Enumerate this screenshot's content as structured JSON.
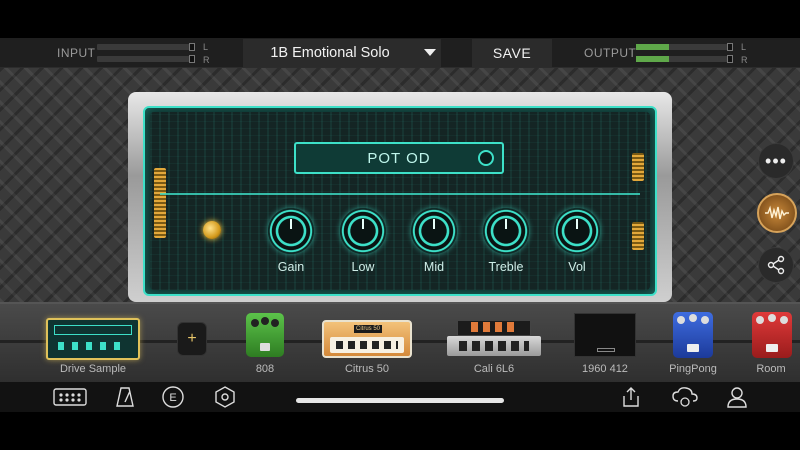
{
  "topbar": {
    "input_label": "INPUT",
    "output_label": "OUTPUT",
    "channel_l": "L",
    "channel_r": "R",
    "input_meter_l": 0.0,
    "input_meter_r": 0.0,
    "output_meter_l": 0.35,
    "output_meter_r": 0.35,
    "preset_name": "1B Emotional Solo",
    "save_label": "SAVE"
  },
  "amp": {
    "name": "POT OD",
    "knobs": [
      {
        "label": "Gain"
      },
      {
        "label": "Low"
      },
      {
        "label": "Mid"
      },
      {
        "label": "Treble"
      },
      {
        "label": "Vol"
      }
    ],
    "accent_color": "#3de0c8"
  },
  "side_buttons": {
    "more_icon": "more-dots-icon",
    "wave_icon": "waveform-icon",
    "share_icon": "share-icon"
  },
  "chain": {
    "items": [
      {
        "label": "Drive Sample",
        "kind": "amp"
      },
      {
        "label": "",
        "kind": "add"
      },
      {
        "label": "808",
        "kind": "pedal"
      },
      {
        "label": "Citrus 50",
        "kind": "amp"
      },
      {
        "label": "Cali 6L6",
        "kind": "amp"
      },
      {
        "label": "1960 412",
        "kind": "cab"
      },
      {
        "label": "PingPong",
        "kind": "pedal"
      },
      {
        "label": "Room",
        "kind": "pedal"
      }
    ],
    "citrus_badge": "Citrus 50",
    "add_symbol": "+"
  },
  "bottombar": {
    "icons": [
      "pedalboard-icon",
      "metronome-icon",
      "tuner-icon",
      "hexagon-icon",
      "upload-icon",
      "cloud-sync-icon",
      "user-icon"
    ],
    "tuner_letter": "E"
  }
}
